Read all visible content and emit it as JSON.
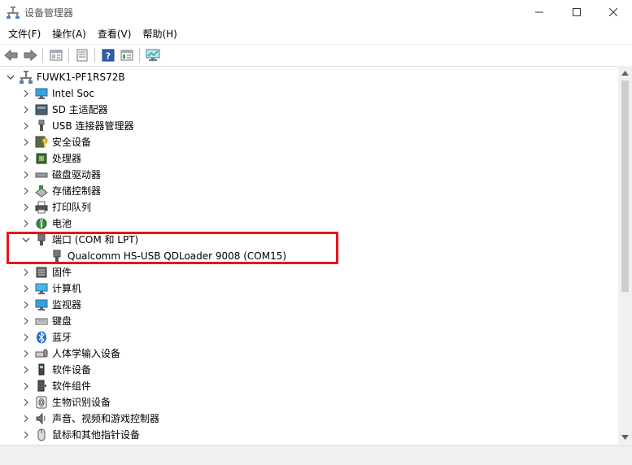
{
  "window": {
    "title": "设备管理器",
    "controls": [
      "minimize",
      "maximize",
      "close"
    ]
  },
  "menu": [
    "文件(F)",
    "操作(A)",
    "查看(V)",
    "帮助(H)"
  ],
  "toolbar": {
    "buttons": [
      "back-icon",
      "forward-icon",
      "properties-icon",
      "update-driver-icon",
      "help-icon",
      "view-icon",
      "scan-hardware-icon"
    ]
  },
  "tree": {
    "root": "FUWK1-PF1RS72B",
    "categories": [
      {
        "label": "Intel Soc",
        "icon": "monitor-icon",
        "expanded": false
      },
      {
        "label": "SD 主适配器",
        "icon": "sd-host-icon",
        "expanded": false
      },
      {
        "label": "USB 连接器管理器",
        "icon": "usb-icon",
        "expanded": false
      },
      {
        "label": "安全设备",
        "icon": "security-key-icon",
        "expanded": false
      },
      {
        "label": "处理器",
        "icon": "processor-icon",
        "expanded": false
      },
      {
        "label": "磁盘驱动器",
        "icon": "disk-icon",
        "expanded": false
      },
      {
        "label": "存储控制器",
        "icon": "storage-controller-icon",
        "expanded": false
      },
      {
        "label": "打印队列",
        "icon": "printer-icon",
        "expanded": false
      },
      {
        "label": "电池",
        "icon": "battery-icon",
        "expanded": false
      },
      {
        "label": "端口 (COM 和 LPT)",
        "icon": "port-icon",
        "expanded": true,
        "children": [
          "Qualcomm HS-USB QDLoader 9008 (COM15)"
        ]
      },
      {
        "label": "固件",
        "icon": "firmware-icon",
        "expanded": false
      },
      {
        "label": "计算机",
        "icon": "computer-icon",
        "expanded": false
      },
      {
        "label": "监视器",
        "icon": "monitor-icon",
        "expanded": false
      },
      {
        "label": "键盘",
        "icon": "keyboard-icon",
        "expanded": false
      },
      {
        "label": "蓝牙",
        "icon": "bluetooth-icon",
        "expanded": false
      },
      {
        "label": "人体学输入设备",
        "icon": "hid-icon",
        "expanded": false
      },
      {
        "label": "软件设备",
        "icon": "software-device-icon",
        "expanded": false
      },
      {
        "label": "软件组件",
        "icon": "software-component-icon",
        "expanded": false
      },
      {
        "label": "生物识别设备",
        "icon": "biometric-icon",
        "expanded": false
      },
      {
        "label": "声音、视频和游戏控制器",
        "icon": "sound-icon",
        "expanded": false
      },
      {
        "label": "鼠标和其他指针设备",
        "icon": "mouse-icon",
        "expanded": false
      }
    ]
  },
  "highlight_color": "#e8141c"
}
